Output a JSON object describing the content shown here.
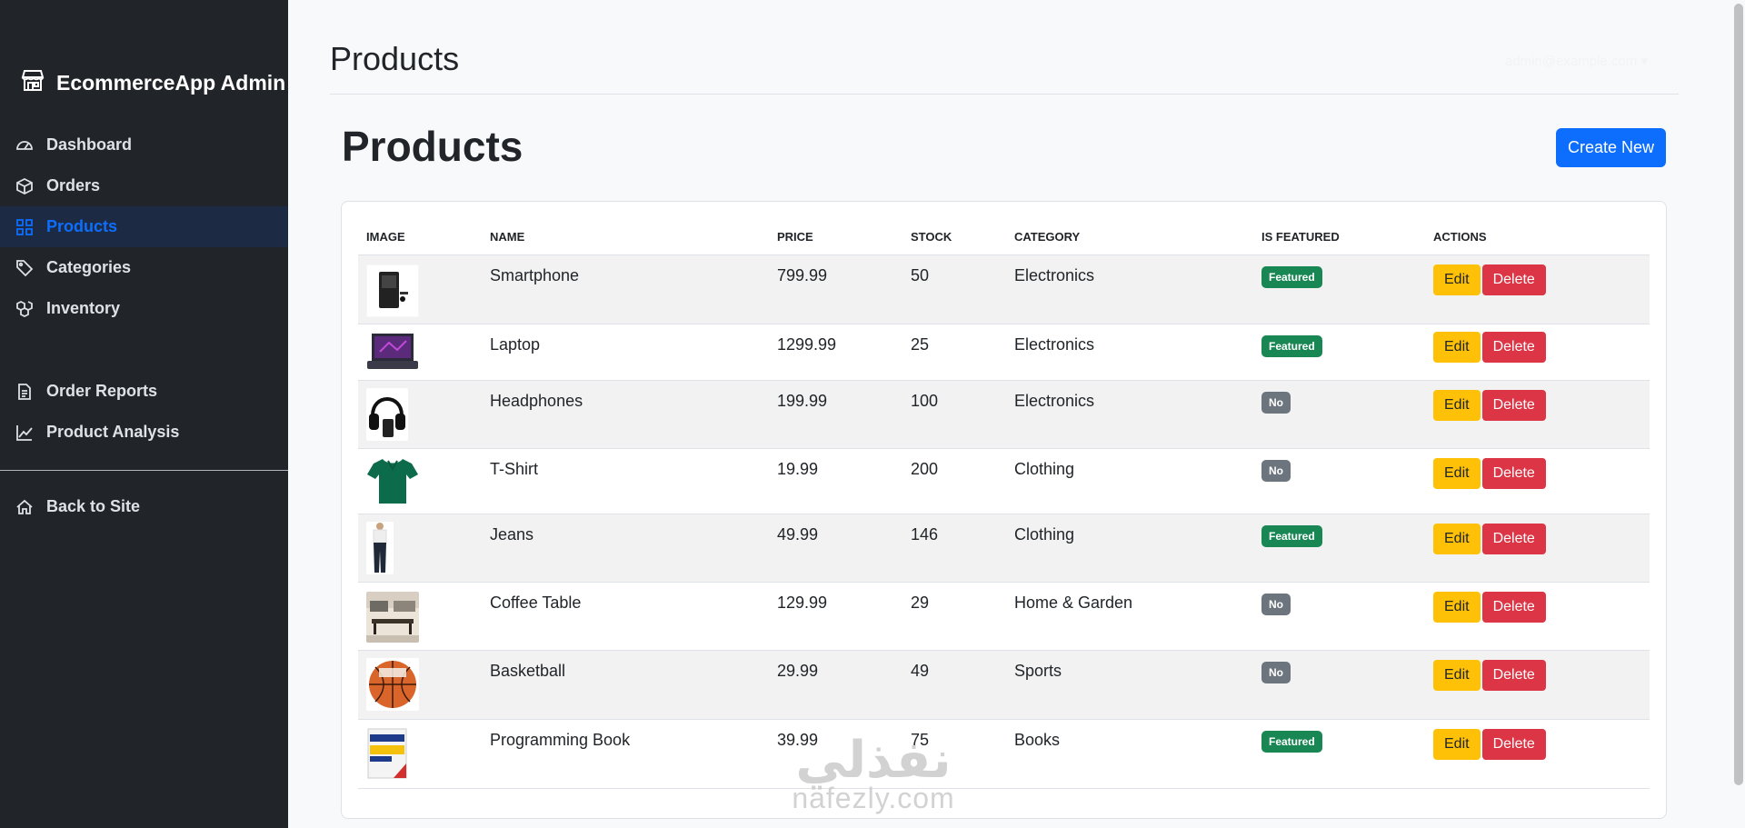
{
  "sidebar": {
    "brand": "EcommerceApp Admin",
    "items": [
      {
        "label": "Dashboard",
        "icon": "speedometer-icon"
      },
      {
        "label": "Orders",
        "icon": "box-icon"
      },
      {
        "label": "Products",
        "icon": "grid-icon",
        "active": true
      },
      {
        "label": "Categories",
        "icon": "tags-icon"
      },
      {
        "label": "Inventory",
        "icon": "boxes-icon"
      },
      {
        "label": "Order Reports",
        "icon": "file-text-icon"
      },
      {
        "label": "Product Analysis",
        "icon": "graph-up-icon"
      },
      {
        "label": "Back to Site",
        "icon": "house-icon"
      }
    ]
  },
  "header": {
    "title": "Products",
    "user_menu": "admin@example.com"
  },
  "main": {
    "heading": "Products",
    "create_button": "Create New",
    "columns": [
      "IMAGE",
      "NAME",
      "PRICE",
      "STOCK",
      "CATEGORY",
      "IS FEATURED",
      "ACTIONS"
    ],
    "rows": [
      {
        "name": "Smartphone",
        "price": "799.99",
        "stock": "50",
        "category": "Electronics",
        "featured": "Featured"
      },
      {
        "name": "Laptop",
        "price": "1299.99",
        "stock": "25",
        "category": "Electronics",
        "featured": "Featured"
      },
      {
        "name": "Headphones",
        "price": "199.99",
        "stock": "100",
        "category": "Electronics",
        "featured": "No"
      },
      {
        "name": "T-Shirt",
        "price": "19.99",
        "stock": "200",
        "category": "Clothing",
        "featured": "No"
      },
      {
        "name": "Jeans",
        "price": "49.99",
        "stock": "146",
        "category": "Clothing",
        "featured": "Featured"
      },
      {
        "name": "Coffee Table",
        "price": "129.99",
        "stock": "29",
        "category": "Home & Garden",
        "featured": "No"
      },
      {
        "name": "Basketball",
        "price": "29.99",
        "stock": "49",
        "category": "Sports",
        "featured": "No"
      },
      {
        "name": "Programming Book",
        "price": "39.99",
        "stock": "75",
        "category": "Books",
        "featured": "Featured"
      }
    ],
    "edit_label": "Edit",
    "delete_label": "Delete"
  },
  "watermark": {
    "arabic": "نفذلي",
    "latin": "nafezly.com"
  },
  "colors": {
    "sidebar_bg": "#212529",
    "primary": "#0d6efd",
    "success": "#198754",
    "secondary": "#6c757d",
    "warning": "#ffc107",
    "danger": "#dc3545"
  }
}
